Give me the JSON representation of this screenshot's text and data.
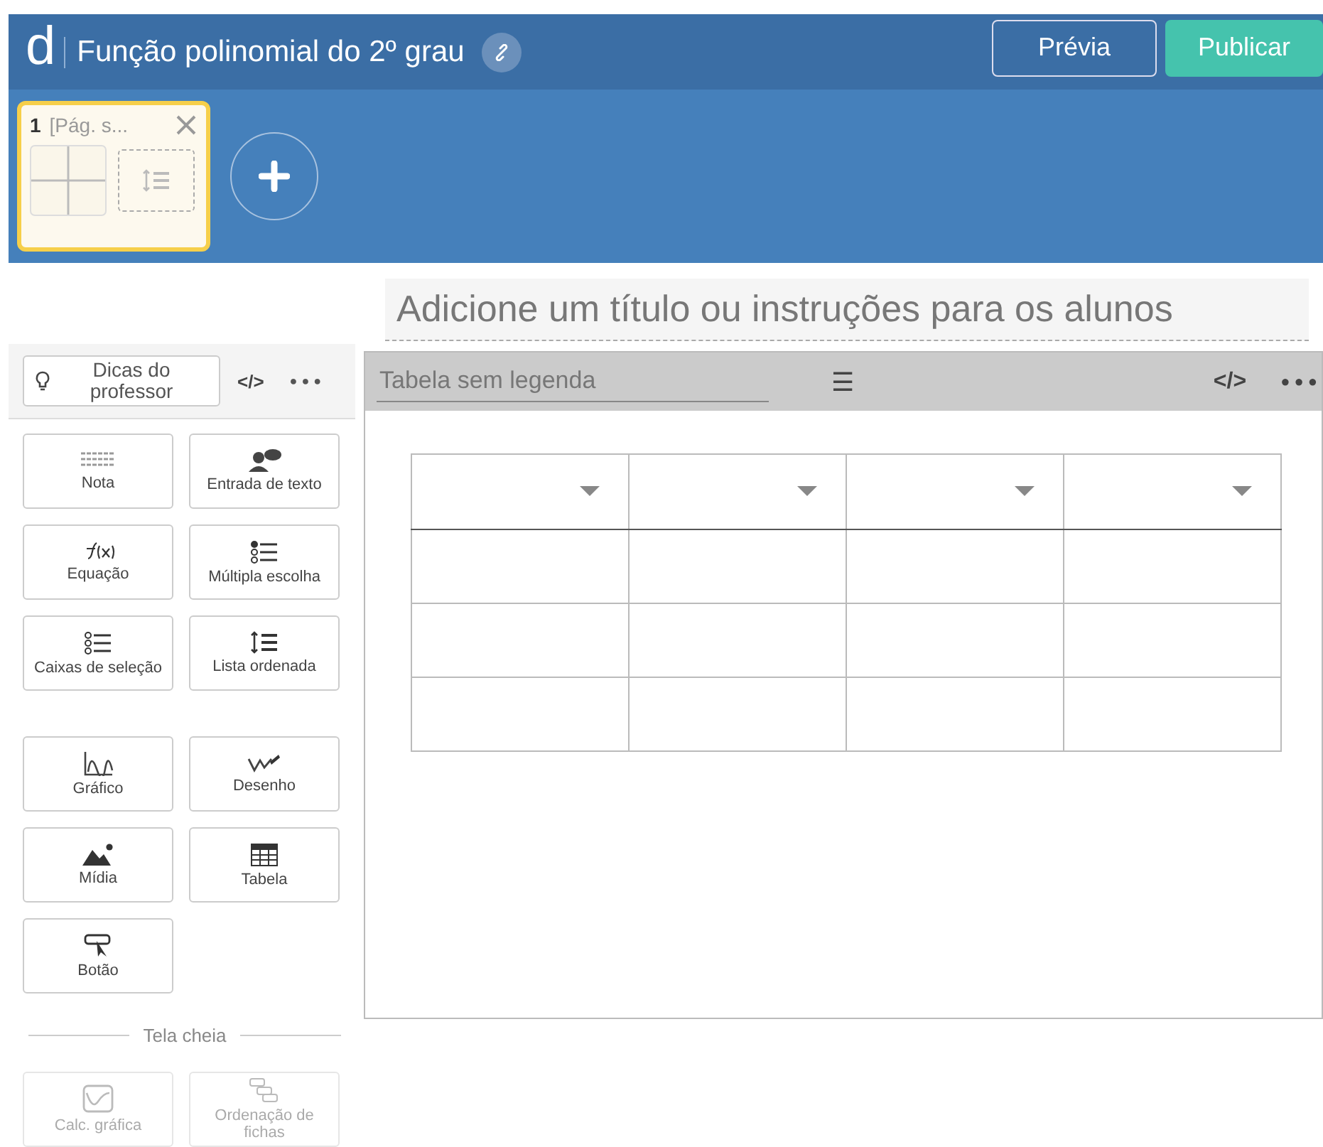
{
  "header": {
    "logo": "d",
    "title": "Função polinomial do 2º grau",
    "buttons": [
      {
        "label": "Prévia",
        "kind": "outline"
      },
      {
        "label": "Publicar",
        "kind": "primary"
      }
    ]
  },
  "pages": [
    {
      "number": "1",
      "title": "[Pág. s...",
      "selected": true
    }
  ],
  "instructions": {
    "placeholder": "Adicione um título ou instruções para os alunos"
  },
  "sidebar": {
    "tips": "Dicas do professor",
    "tools": [
      {
        "label": "Nota",
        "disabled": false
      },
      {
        "label": "Entrada de texto",
        "disabled": false
      },
      {
        "label": "Equação",
        "disabled": false
      },
      {
        "label": "Múltipla escolha",
        "disabled": false
      },
      {
        "label": "Caixas de seleção",
        "disabled": false
      },
      {
        "label": "Lista ordenada",
        "disabled": false
      }
    ],
    "tools2": [
      {
        "label": "Gráfico",
        "disabled": false
      },
      {
        "label": "Desenho",
        "disabled": false
      },
      {
        "label": "Mídia",
        "disabled": false
      },
      {
        "label": "Tabela",
        "disabled": false
      },
      {
        "label": "Botão",
        "disabled": false
      }
    ],
    "section": "Tela cheia",
    "tools3": [
      {
        "label": "Calc. gráfica",
        "disabled": true
      },
      {
        "label": "Ordenação de fichas",
        "disabled": true
      }
    ]
  },
  "panel": {
    "caption_placeholder": "Tabela sem legenda",
    "menu": "☰",
    "code": "</>",
    "more": "●●●"
  }
}
